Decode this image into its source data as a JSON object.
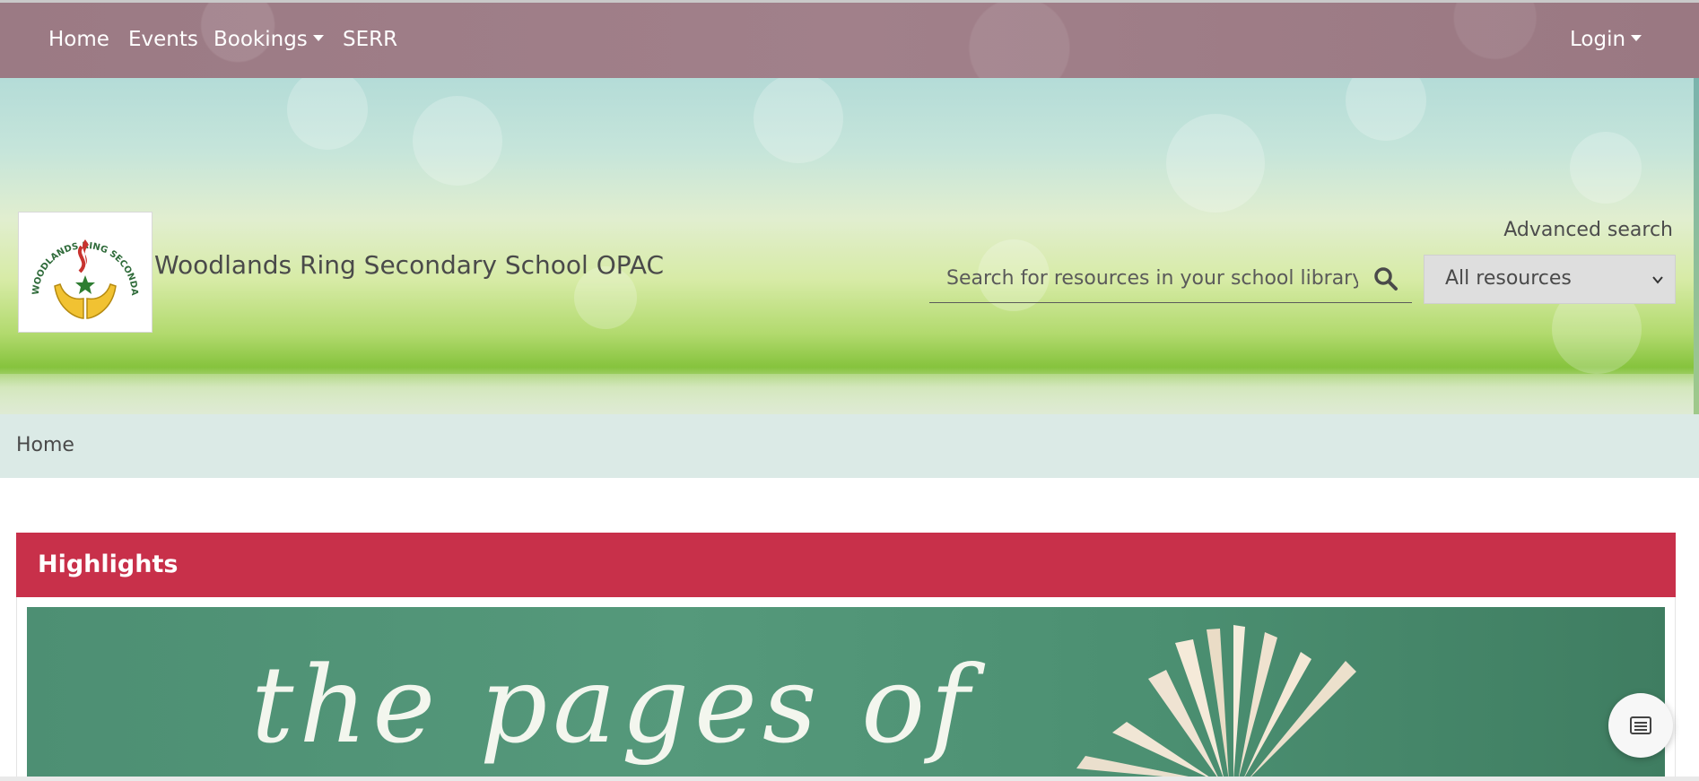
{
  "nav": {
    "items": [
      {
        "label": "Home"
      },
      {
        "label": "Events"
      },
      {
        "label": "Bookings"
      },
      {
        "label": "SERR"
      }
    ],
    "login_label": "Login"
  },
  "header": {
    "site_title": "Woodlands Ring Secondary School OPAC",
    "logo_text": "WOODLANDS RING SECONDARY SCHOOL",
    "advanced_search_label": "Advanced search",
    "search": {
      "placeholder": "Search for resources in your school library",
      "value": ""
    },
    "resource_filter": {
      "selected": "All resources"
    }
  },
  "breadcrumb": {
    "current": "Home"
  },
  "highlights": {
    "title": "Highlights",
    "banner_text": "the pages of"
  },
  "colors": {
    "navbar": "#9b7a84",
    "highlights_header": "#c8304a",
    "breadcrumb_bg": "#dbeae6",
    "banner_bg": "#4d8f73"
  },
  "icons": {
    "search": "search-icon",
    "chevron": "chevron-down-icon",
    "list": "list-icon"
  }
}
